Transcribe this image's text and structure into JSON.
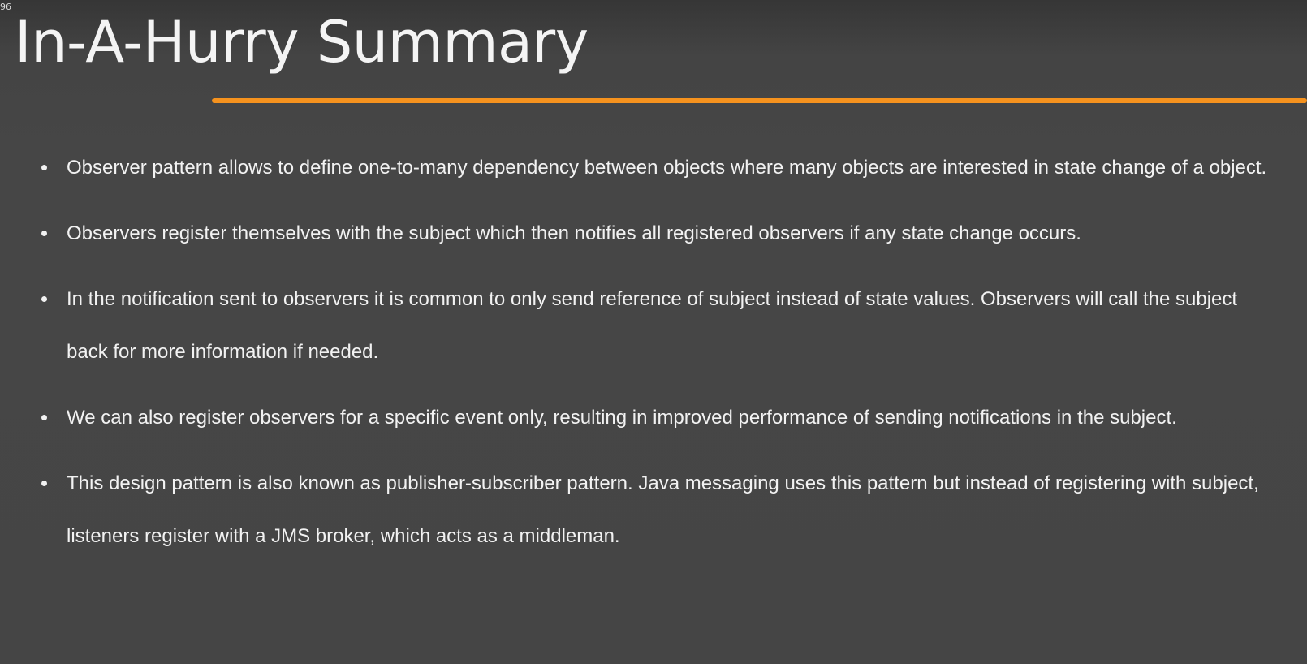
{
  "corner_label": "96",
  "title": "In-A-Hurry Summary",
  "colors": {
    "background": "#464646",
    "accent": "#f5921e",
    "text": "#f2f2f2"
  },
  "bullets": [
    {
      "text": "Observer pattern allows to define one-to-many dependency between objects where many objects are interested in state change of a object."
    },
    {
      "text": "Observers register themselves with the subject which then notifies all registered observers if any state change occurs."
    },
    {
      "text": "In the notification sent to observers it is common to only send reference of subject instead of state values. Observers will call the subject back for more information if needed."
    },
    {
      "text": "We can also register observers for a specific event only, resulting in improved performance of sending notifications in the subject."
    },
    {
      "text": "This design pattern is also known as publisher-subscriber pattern. Java messaging uses this pattern but instead of registering with subject, listeners register with a JMS broker, which acts as a middleman."
    }
  ]
}
